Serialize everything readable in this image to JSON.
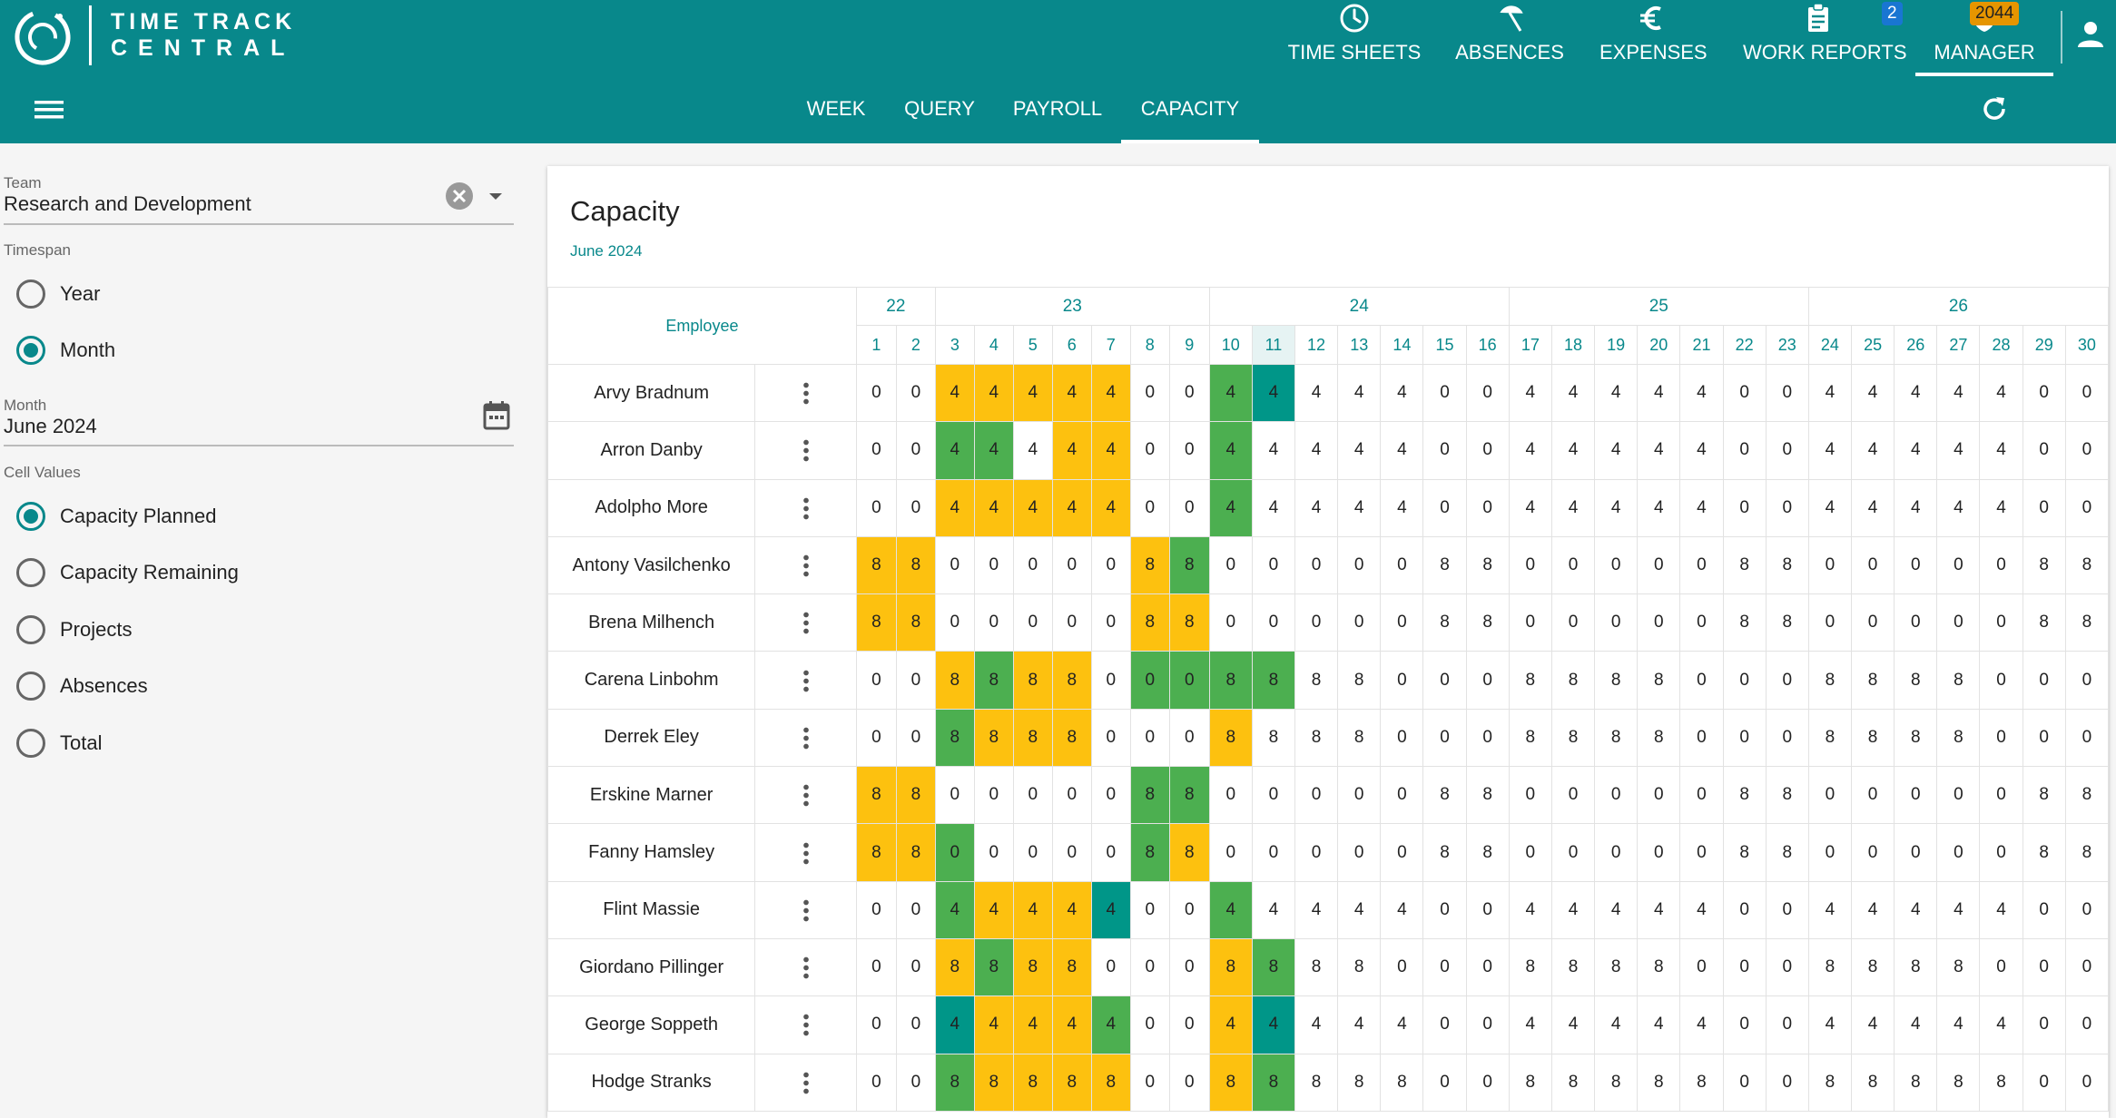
{
  "header": {
    "brand_line1": "TIME TRACK",
    "brand_line2": "CENTRAL",
    "nav": [
      {
        "label": "TIME SHEETS",
        "icon": "clock-icon"
      },
      {
        "label": "ABSENCES",
        "icon": "umbrella-icon"
      },
      {
        "label": "EXPENSES",
        "icon": "euro-icon"
      },
      {
        "label": "WORK REPORTS",
        "icon": "clipboard-icon",
        "badge": "2"
      },
      {
        "label": "MANAGER",
        "icon": "shield-icon",
        "badge": "2044",
        "active": true
      }
    ],
    "subtabs": [
      "WEEK",
      "QUERY",
      "PAYROLL",
      "CAPACITY"
    ],
    "active_subtab": "CAPACITY"
  },
  "filters": {
    "team_label": "Team",
    "team_value": "Research and Development",
    "timespan_label": "Timespan",
    "timespan_options": [
      "Year",
      "Month"
    ],
    "timespan_selected": "Month",
    "month_label": "Month",
    "month_value": "June 2024",
    "cell_values_label": "Cell Values",
    "cell_values_options": [
      "Capacity Planned",
      "Capacity Remaining",
      "Projects",
      "Absences",
      "Total"
    ],
    "cell_values_selected": "Capacity Planned"
  },
  "capacity": {
    "title": "Capacity",
    "subtitle": "June 2024",
    "employee_header": "Employee",
    "weeks": [
      {
        "label": "22",
        "span": 2
      },
      {
        "label": "23",
        "span": 7
      },
      {
        "label": "24",
        "span": 7
      },
      {
        "label": "25",
        "span": 7
      },
      {
        "label": "26",
        "span": 7
      }
    ],
    "days": [
      "1",
      "2",
      "3",
      "4",
      "5",
      "6",
      "7",
      "8",
      "9",
      "10",
      "11",
      "12",
      "13",
      "14",
      "15",
      "16",
      "17",
      "18",
      "19",
      "20",
      "21",
      "22",
      "23",
      "24",
      "25",
      "26",
      "27",
      "28",
      "29",
      "30"
    ],
    "highlight_day": "11",
    "colors": {
      "y": "#fdc10f",
      "g": "#4caf50",
      "t": "#009688"
    },
    "rows": [
      {
        "name": "Arvy Bradnum",
        "values": [
          0,
          0,
          4,
          4,
          4,
          4,
          4,
          0,
          0,
          4,
          4,
          4,
          4,
          4,
          0,
          0,
          4,
          4,
          4,
          4,
          4,
          0,
          0,
          4,
          4,
          4,
          4,
          4,
          0,
          0
        ],
        "colors": "..yyyyy..gt..................."
      },
      {
        "name": "Arron Danby",
        "values": [
          0,
          0,
          4,
          4,
          4,
          4,
          4,
          0,
          0,
          4,
          4,
          4,
          4,
          4,
          0,
          0,
          4,
          4,
          4,
          4,
          4,
          0,
          0,
          4,
          4,
          4,
          4,
          4,
          0,
          0
        ],
        "colors": "..gg.yy..g...................."
      },
      {
        "name": "Adolpho More",
        "values": [
          0,
          0,
          4,
          4,
          4,
          4,
          4,
          0,
          0,
          4,
          4,
          4,
          4,
          4,
          0,
          0,
          4,
          4,
          4,
          4,
          4,
          0,
          0,
          4,
          4,
          4,
          4,
          4,
          0,
          0
        ],
        "colors": "..yyyyy..g...................."
      },
      {
        "name": "Antony Vasilchenko",
        "values": [
          8,
          8,
          0,
          0,
          0,
          0,
          0,
          8,
          8,
          0,
          0,
          0,
          0,
          0,
          8,
          8,
          0,
          0,
          0,
          0,
          0,
          8,
          8,
          0,
          0,
          0,
          0,
          0,
          8,
          8
        ],
        "colors": "yy.....yg....................."
      },
      {
        "name": "Brena Milhench",
        "values": [
          8,
          8,
          0,
          0,
          0,
          0,
          0,
          8,
          8,
          0,
          0,
          0,
          0,
          0,
          8,
          8,
          0,
          0,
          0,
          0,
          0,
          8,
          8,
          0,
          0,
          0,
          0,
          0,
          8,
          8
        ],
        "colors": "yy.....yy....................."
      },
      {
        "name": "Carena Linbohm",
        "values": [
          0,
          0,
          8,
          8,
          8,
          8,
          0,
          0,
          0,
          8,
          8,
          8,
          8,
          0,
          0,
          0,
          8,
          8,
          8,
          8,
          0,
          0,
          0,
          8,
          8,
          8,
          8,
          0,
          0,
          0
        ],
        "colors": "..ygyy.gggg..................."
      },
      {
        "name": "Derrek Eley",
        "values": [
          0,
          0,
          8,
          8,
          8,
          8,
          0,
          0,
          0,
          8,
          8,
          8,
          8,
          0,
          0,
          0,
          8,
          8,
          8,
          8,
          0,
          0,
          0,
          8,
          8,
          8,
          8,
          0,
          0,
          0
        ],
        "colors": "..gyyy...y...................."
      },
      {
        "name": "Erskine Marner",
        "values": [
          8,
          8,
          0,
          0,
          0,
          0,
          0,
          8,
          8,
          0,
          0,
          0,
          0,
          0,
          8,
          8,
          0,
          0,
          0,
          0,
          0,
          8,
          8,
          0,
          0,
          0,
          0,
          0,
          8,
          8
        ],
        "colors": "yy.....gg....................."
      },
      {
        "name": "Fanny Hamsley",
        "values": [
          8,
          8,
          0,
          0,
          0,
          0,
          0,
          8,
          8,
          0,
          0,
          0,
          0,
          0,
          8,
          8,
          0,
          0,
          0,
          0,
          0,
          8,
          8,
          0,
          0,
          0,
          0,
          0,
          8,
          8
        ],
        "colors": "yyg....gy....................."
      },
      {
        "name": "Flint Massie",
        "values": [
          0,
          0,
          4,
          4,
          4,
          4,
          4,
          0,
          0,
          4,
          4,
          4,
          4,
          4,
          0,
          0,
          4,
          4,
          4,
          4,
          4,
          0,
          0,
          4,
          4,
          4,
          4,
          4,
          0,
          0
        ],
        "colors": "..gyyyt..g...................."
      },
      {
        "name": "Giordano Pillinger",
        "values": [
          0,
          0,
          8,
          8,
          8,
          8,
          0,
          0,
          0,
          8,
          8,
          8,
          8,
          0,
          0,
          0,
          8,
          8,
          8,
          8,
          0,
          0,
          0,
          8,
          8,
          8,
          8,
          0,
          0,
          0
        ],
        "colors": "..ygyy...yg..................."
      },
      {
        "name": "George Soppeth",
        "values": [
          0,
          0,
          4,
          4,
          4,
          4,
          4,
          0,
          0,
          4,
          4,
          4,
          4,
          4,
          0,
          0,
          4,
          4,
          4,
          4,
          4,
          0,
          0,
          4,
          4,
          4,
          4,
          4,
          0,
          0
        ],
        "colors": "..tyyyg..yt..................."
      },
      {
        "name": "Hodge Stranks",
        "values": [
          0,
          0,
          8,
          8,
          8,
          8,
          8,
          0,
          0,
          8,
          8,
          8,
          8,
          8,
          0,
          0,
          8,
          8,
          8,
          8,
          8,
          0,
          0,
          8,
          8,
          8,
          8,
          8,
          0,
          0
        ],
        "colors": "..gyyyy..yg..................."
      }
    ]
  }
}
